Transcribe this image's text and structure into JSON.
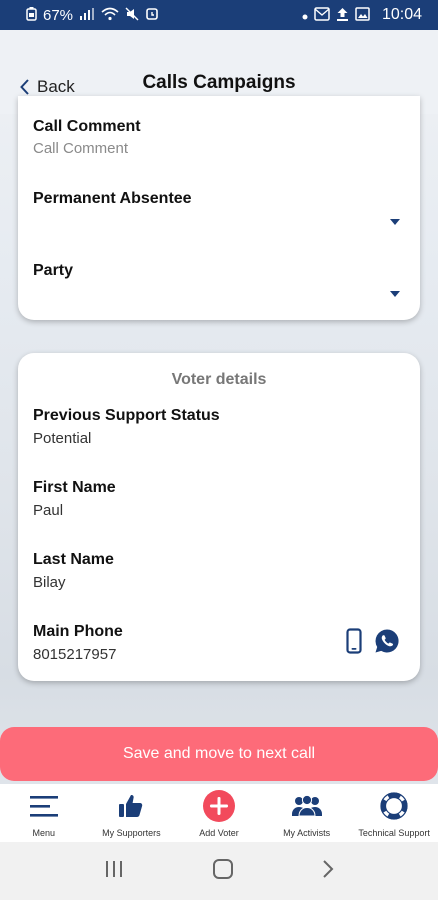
{
  "status_bar": {
    "battery": "67%",
    "time": "10:04"
  },
  "header": {
    "back_label": "Back",
    "title": "Calls Campaigns"
  },
  "campaign_form": {
    "call_comment_label": "Call Comment",
    "call_comment_placeholder": "Call Comment",
    "permanent_absentee_label": "Permanent Absentee",
    "party_label": "Party"
  },
  "voter_details": {
    "heading": "Voter details",
    "fields": [
      {
        "label": "Previous Support Status",
        "value": "Potential"
      },
      {
        "label": "First Name",
        "value": "Paul"
      },
      {
        "label": "Last Name",
        "value": "Bilay"
      },
      {
        "label": "Main Phone",
        "value": "8015217957"
      }
    ]
  },
  "save_button": "Save and move to next call",
  "bottom_nav": [
    {
      "label": "Menu",
      "icon": "menu-icon"
    },
    {
      "label": "My Supporters",
      "icon": "thumbs-up-icon"
    },
    {
      "label": "Add Voter",
      "icon": "add-icon"
    },
    {
      "label": "My Activists",
      "icon": "people-icon"
    },
    {
      "label": "Technical Support",
      "icon": "lifebuoy-icon"
    }
  ],
  "colors": {
    "brand_navy": "#1b3e78",
    "save_button": "#fd6b79",
    "add_voter": "#f24a5c"
  }
}
